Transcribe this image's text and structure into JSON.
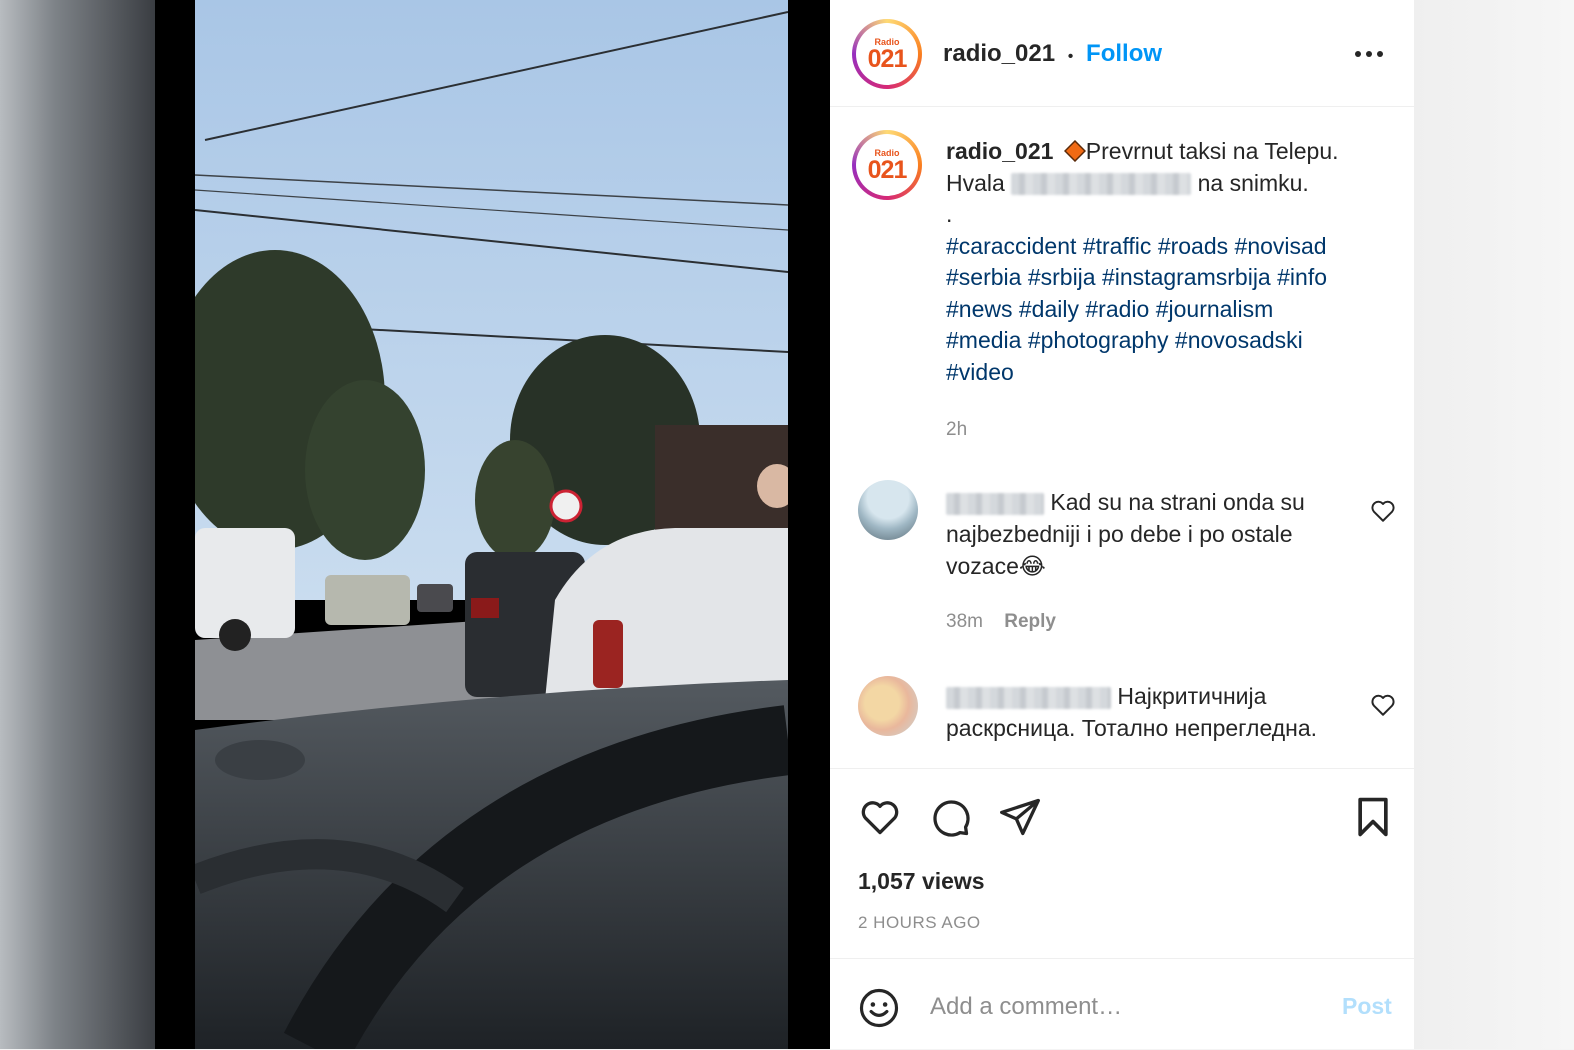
{
  "post": {
    "username": "radio_021",
    "separator": "•",
    "follow_label": "Follow",
    "avatar_logo_top": "Radio",
    "avatar_logo_num": "021",
    "caption": {
      "username": "radio_021",
      "line1": "Prevrnut taksi na Telepu.",
      "hvala": "Hvala",
      "na_snimku": "na snimku.",
      "dot": ".",
      "hashtags": [
        "#caraccident",
        "#traffic",
        "#roads",
        "#novisad",
        "#serbia",
        "#srbija",
        "#instagramsrbija",
        "#info",
        "#news",
        "#daily",
        "#radio",
        "#journalism",
        "#media",
        "#photography",
        "#novosadski",
        "#video"
      ],
      "time": "2h"
    },
    "comments": [
      {
        "text": "Kad su na strani onda su najbezbedniji i po debe i po ostale vozace😂",
        "time": "38m",
        "reply_label": "Reply"
      },
      {
        "text": "Најкритичнија раскрсница. Тотално непрегледна."
      }
    ],
    "views": "1,057 views",
    "posted_ago": "2 HOURS AGO",
    "add_comment_placeholder": "Add a comment…",
    "post_label": "Post"
  },
  "icons": [
    "more-icon",
    "diamond-icon",
    "heart-icon",
    "comment-icon",
    "share-icon",
    "bookmark-icon",
    "emoji-icon"
  ],
  "colors": {
    "link_blue": "#0095f6",
    "hashtag": "#00376b",
    "post_disabled": "#b2dffc",
    "brand_orange": "#e8541c"
  }
}
